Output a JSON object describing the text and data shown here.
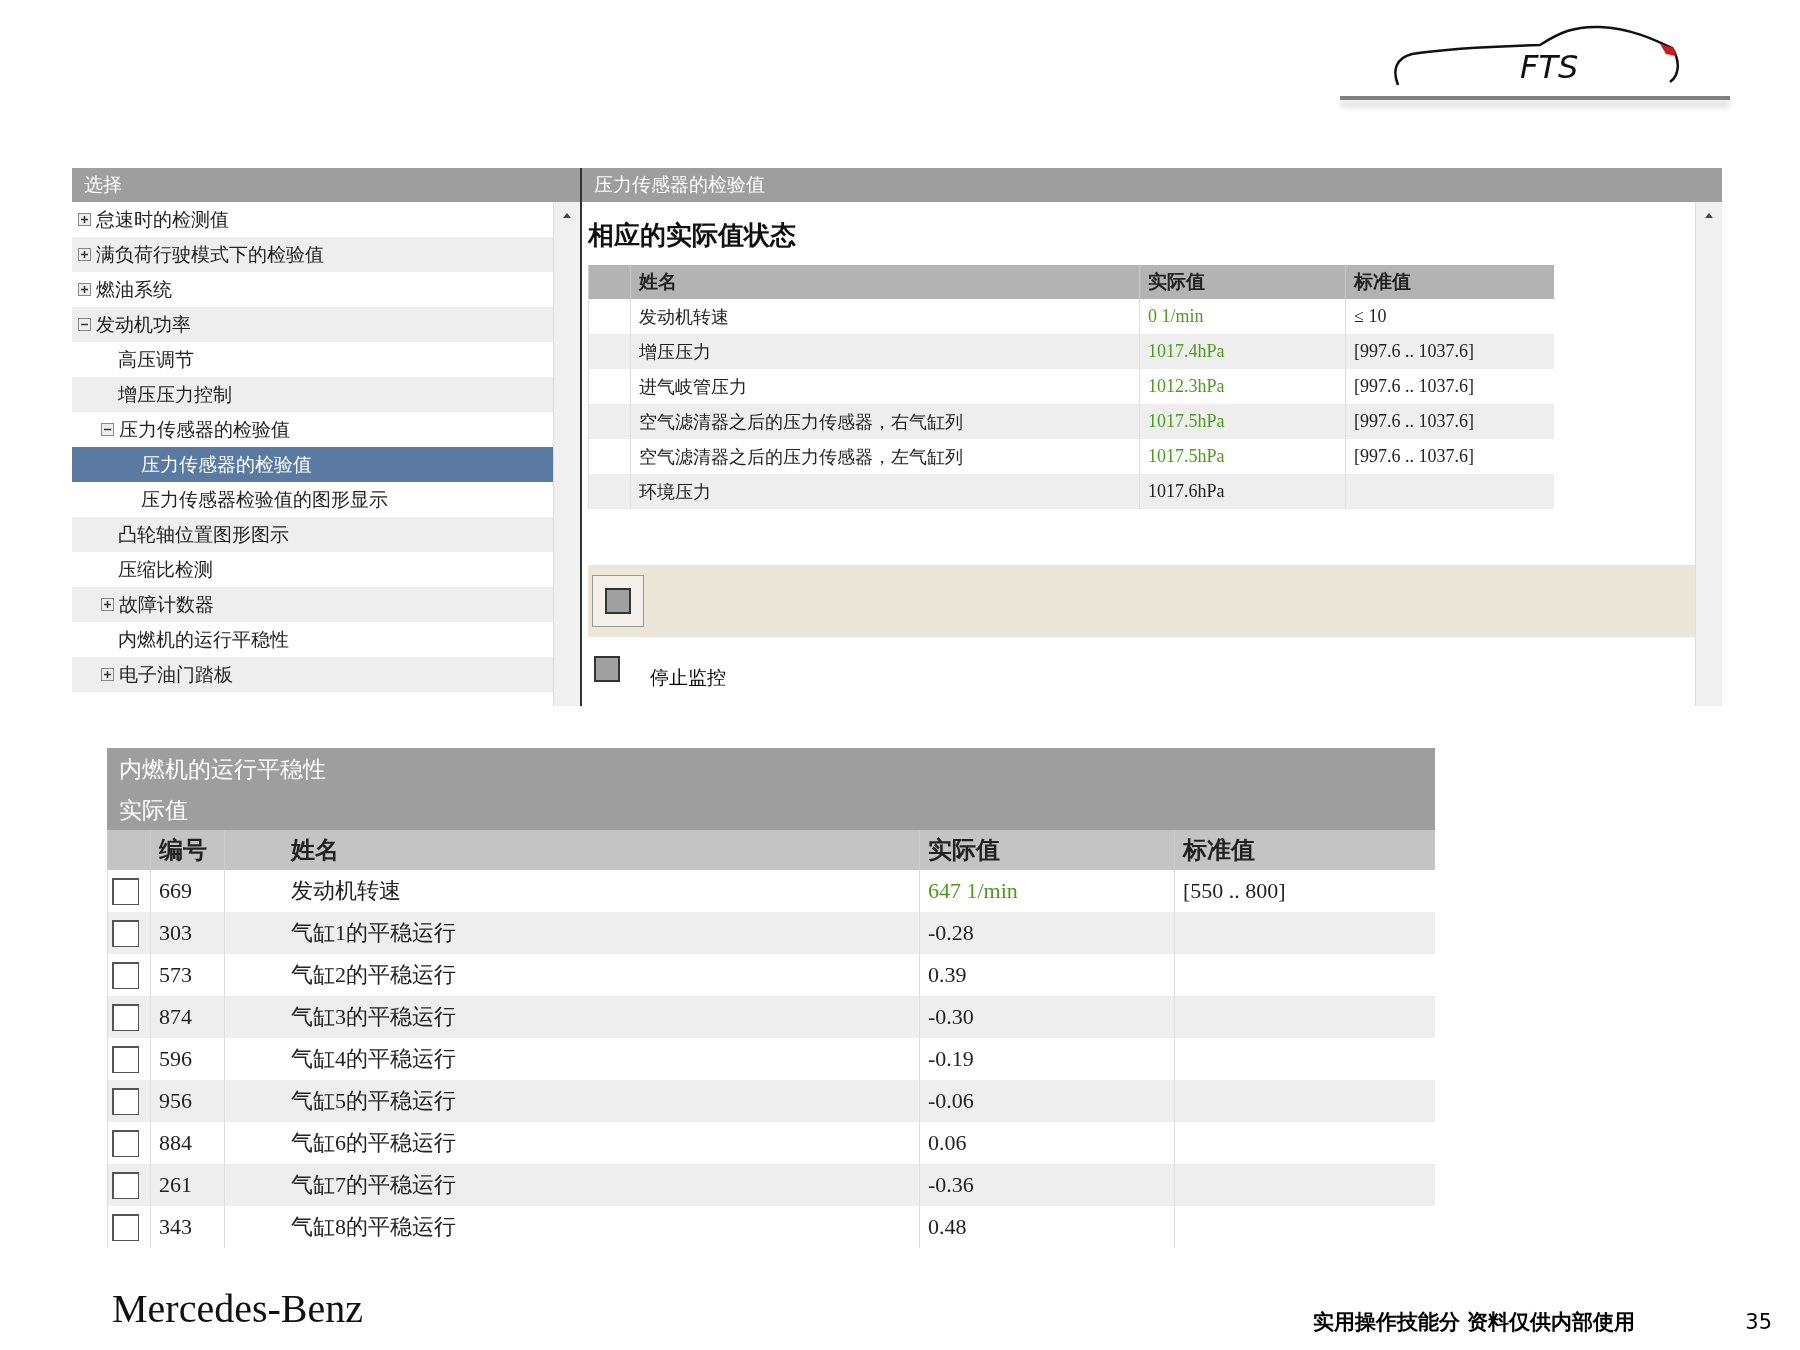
{
  "logo": {
    "text": "FTS"
  },
  "selection_panel": {
    "title": "选择",
    "tree": [
      {
        "label": "怠速时的检测值",
        "expanded": false,
        "selected": false
      },
      {
        "label": "满负荷行驶模式下的检验值",
        "expanded": false,
        "selected": false
      },
      {
        "label": "燃油系统",
        "expanded": false,
        "selected": false
      },
      {
        "label": "发动机功率",
        "expanded": true,
        "selected": false,
        "children": [
          {
            "label": "高压调节",
            "selected": false
          },
          {
            "label": "增压压力控制",
            "selected": false
          },
          {
            "label": "压力传感器的检验值",
            "expanded": true,
            "selected": false,
            "children": [
              {
                "label": "压力传感器的检验值",
                "selected": true
              },
              {
                "label": "压力传感器检验值的图形显示",
                "selected": false
              }
            ]
          },
          {
            "label": "凸轮轴位置图形图示",
            "selected": false
          },
          {
            "label": "压缩比检测",
            "selected": false
          },
          {
            "label": "故障计数器",
            "expanded": false,
            "selected": false
          },
          {
            "label": "内燃机的运行平稳性",
            "selected": false
          },
          {
            "label": "电子油门踏板",
            "expanded": false,
            "selected": false
          }
        ]
      }
    ]
  },
  "detail_panel": {
    "title": "压力传感器的检验值",
    "heading": "相应的实际值状态",
    "columns": [
      "姓名",
      "实际值",
      "标准值"
    ],
    "rows": [
      {
        "name": "发动机转速",
        "actual": "0 1/min",
        "color": "#4e9a1e",
        "standard": "≤ 10"
      },
      {
        "name": "增压压力",
        "actual": "1017.4hPa",
        "color": "#4e9a1e",
        "standard": "[997.6 .. 1037.6]"
      },
      {
        "name": "进气岐管压力",
        "actual": "1012.3hPa",
        "color": "#4e9a1e",
        "standard": "[997.6 .. 1037.6]"
      },
      {
        "name": "空气滤清器之后的压力传感器，右气缸列",
        "actual": "1017.5hPa",
        "color": "#4e9a1e",
        "standard": "[997.6 .. 1037.6]"
      },
      {
        "name": "空气滤清器之后的压力传感器，左气缸列",
        "actual": "1017.5hPa",
        "color": "#4e9a1e",
        "standard": "[997.6 .. 1037.6]"
      },
      {
        "name": "环境压力",
        "actual": "1017.6hPa",
        "color": "#222222"
      }
    ],
    "monitor_label": "停止监控"
  },
  "smoothness_panel": {
    "title": "内燃机的运行平稳性",
    "subtitle": "实际值",
    "columns": [
      "编号",
      "姓名",
      "实际值",
      "标准值"
    ],
    "rows": [
      {
        "checked": false,
        "number": "669",
        "name": "发动机转速",
        "actual": "647 1/min",
        "color": "#4e9a1e",
        "standard": "[550 .. 800]"
      },
      {
        "checked": false,
        "number": "303",
        "name": "气缸1的平稳运行",
        "actual": "-0.28",
        "color": "#222222"
      },
      {
        "checked": false,
        "number": "573",
        "name": "气缸2的平稳运行",
        "actual": "0.39",
        "color": "#222222"
      },
      {
        "checked": false,
        "number": "874",
        "name": "气缸3的平稳运行",
        "actual": "-0.30",
        "color": "#222222"
      },
      {
        "checked": false,
        "number": "596",
        "name": "气缸4的平稳运行",
        "actual": "-0.19",
        "color": "#222222"
      },
      {
        "checked": false,
        "number": "956",
        "name": "气缸5的平稳运行",
        "actual": "-0.06",
        "color": "#222222"
      },
      {
        "checked": false,
        "number": "884",
        "name": "气缸6的平稳运行",
        "actual": "0.06",
        "color": "#222222"
      },
      {
        "checked": false,
        "number": "261",
        "name": "气缸7的平稳运行",
        "actual": "-0.36",
        "color": "#222222"
      },
      {
        "checked": false,
        "number": "343",
        "name": "气缸8的平稳运行",
        "actual": "0.48",
        "color": "#222222"
      }
    ]
  },
  "footer": {
    "brand": "Mercedes-Benz",
    "note": "实用操作技能分 资料仅供内部使用",
    "page": "35"
  }
}
